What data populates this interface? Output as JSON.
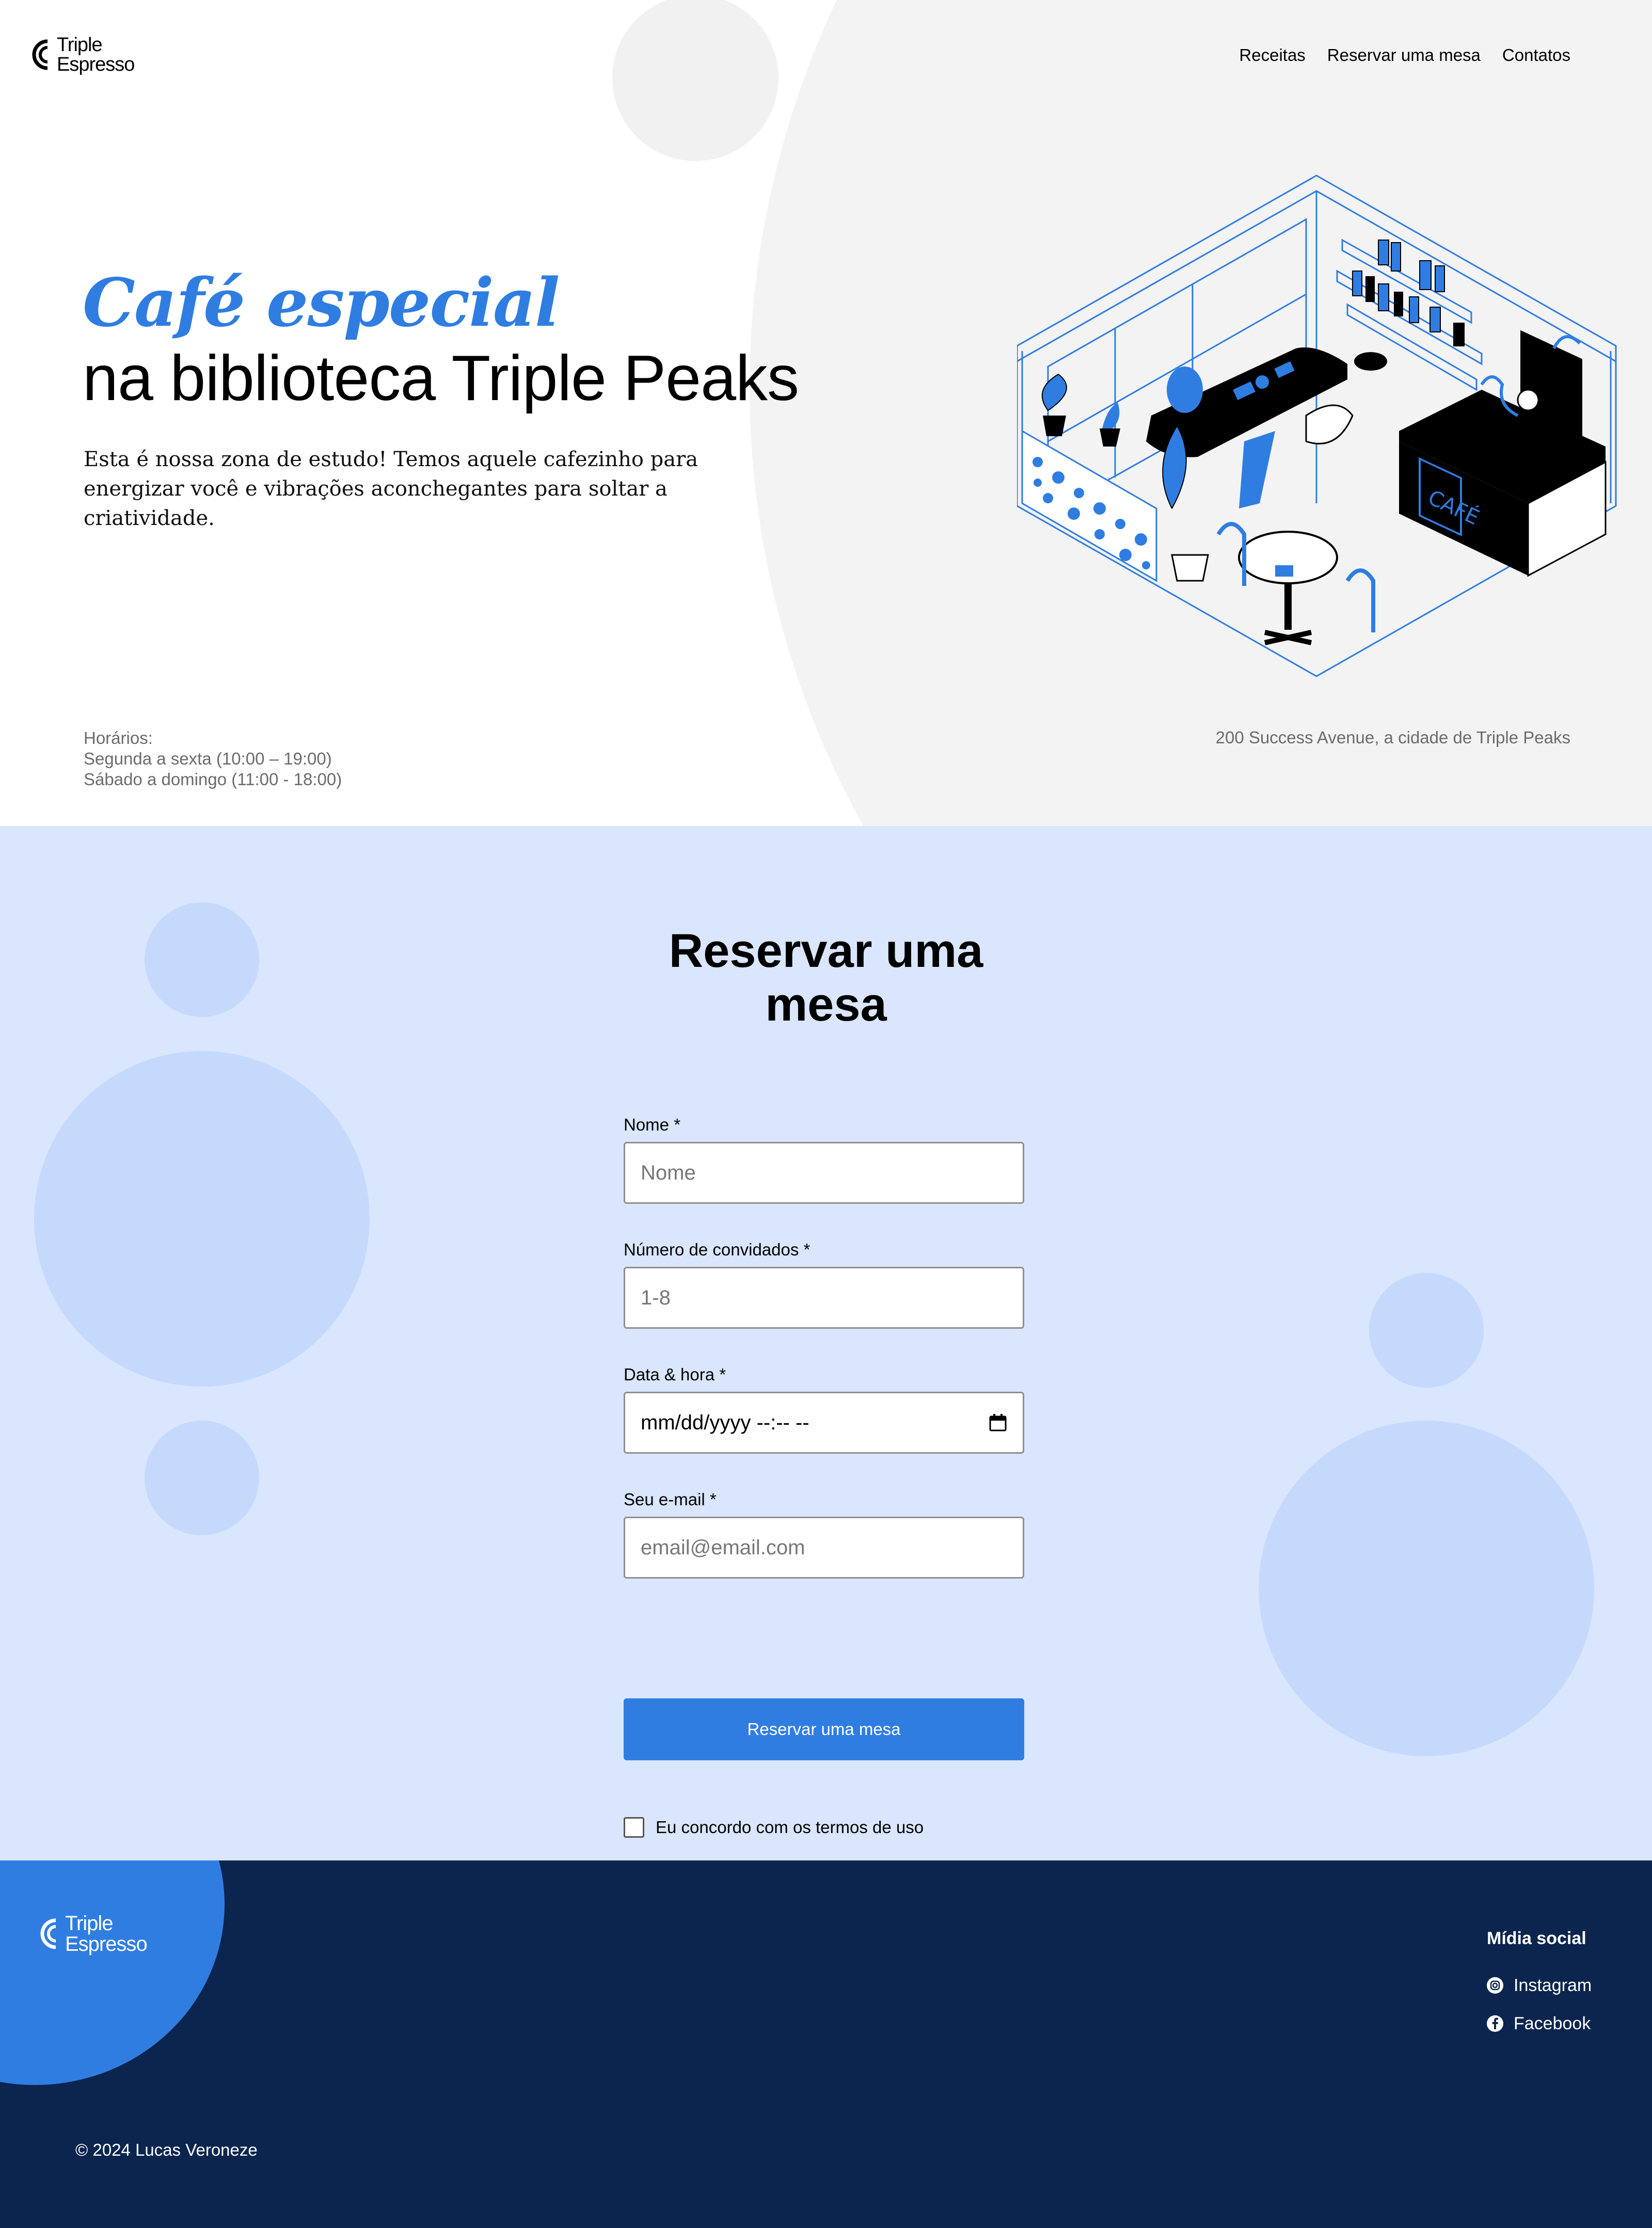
{
  "brand": {
    "name_line1": "Triple",
    "name_line2": "Espresso"
  },
  "nav": {
    "items": [
      "Receitas",
      "Reservar uma mesa",
      "Contatos"
    ]
  },
  "hero": {
    "title_highlight": "Café especial",
    "title_rest": "na biblioteca Triple Peaks",
    "description": "Esta é nossa zona de estudo! Temos aquele cafezinho para energizar você e vibrações aconchegantes para soltar a criatividade.",
    "hours_title": "Horários:",
    "hours_weekdays": "Segunda a sexta (10:00 – 19:00)",
    "hours_weekend": "Sábado a domingo (11:00 - 18:00)",
    "address": "200 Success Avenue, a cidade de Triple Peaks",
    "illustration_sign": "CAFÉ"
  },
  "reservation": {
    "title_line1": "Reservar uma",
    "title_line2": "mesa",
    "fields": [
      {
        "label": "Nome *",
        "placeholder": "Nome"
      },
      {
        "label": "Número de convidados *",
        "placeholder": "1-8"
      },
      {
        "label": "Data & hora *",
        "value": "mm/dd/yyyy --:-- --"
      },
      {
        "label": "Seu e-mail *",
        "placeholder": "email@email.com"
      }
    ],
    "submit_label": "Reservar uma mesa",
    "terms_label": "Eu concordo com os termos de uso"
  },
  "footer": {
    "social_title": "Mídia social",
    "social_items": [
      "Instagram",
      "Facebook"
    ],
    "copyright": "© 2024 Lucas Veroneze"
  },
  "colors": {
    "accent": "#2f7de1",
    "light_blue": "#d9e6fd",
    "deco_blue": "#c5d9fd",
    "navy": "#0b254f",
    "hero_gray": "#f3f3f3"
  }
}
